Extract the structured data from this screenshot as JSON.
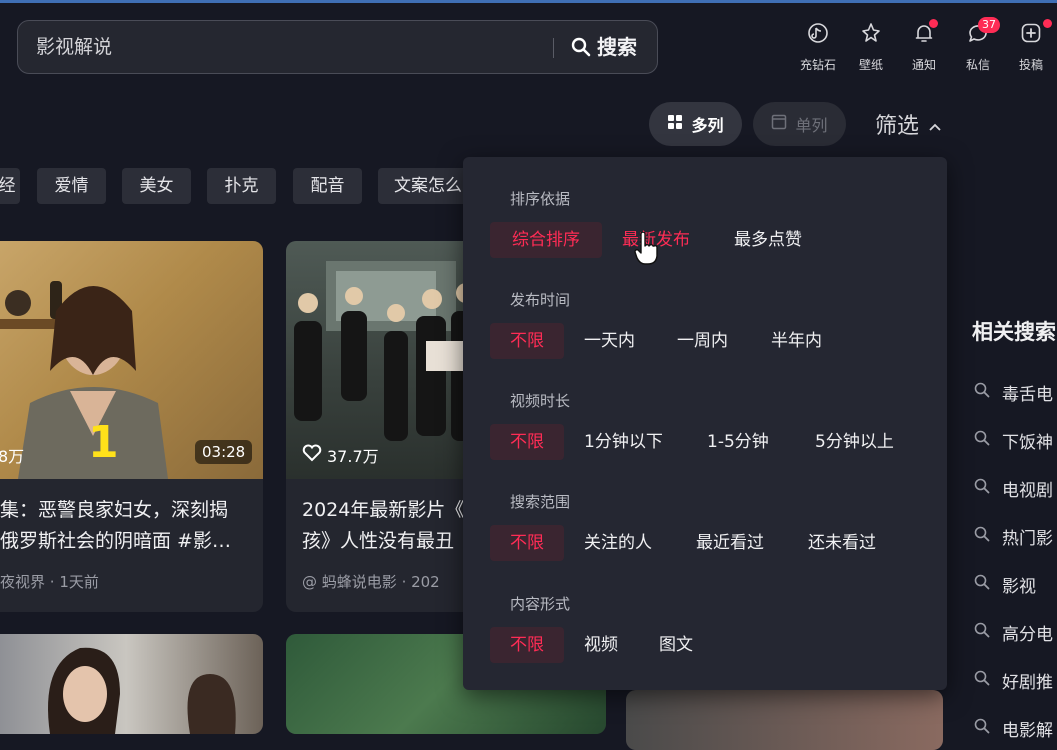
{
  "search": {
    "query": "影视解说",
    "button_label": "搜索"
  },
  "top_nav": [
    {
      "icon": "diamond-icon",
      "label": "充钻石"
    },
    {
      "icon": "wallpaper-icon",
      "label": "壁纸"
    },
    {
      "icon": "bell-icon",
      "label": "通知"
    },
    {
      "icon": "message-icon",
      "label": "私信",
      "badge": "37"
    },
    {
      "icon": "upload-icon",
      "label": "投稿"
    }
  ],
  "view_toggle": {
    "multi_label": "多列",
    "single_label": "单列"
  },
  "filter_label": "筛选",
  "tags": [
    "爱情",
    "美女",
    "扑克",
    "配音",
    "文案怎么"
  ],
  "cards": [
    {
      "likes": "8万",
      "duration": "03:28",
      "overlay_number": "1",
      "title_line1": "集：恶警良家妇女，深刻揭",
      "title_line2": "俄罗斯社会的阴暗面 #影…",
      "author": "夜视界",
      "time": "· 1天前"
    },
    {
      "likes": "37.7万",
      "title_line1": "2024年最新影片《",
      "title_line2": "孩》人性没有最丑",
      "author": "@ 蚂蜂说电影",
      "time": "· 202"
    }
  ],
  "related": {
    "title": "相关搜索",
    "items": [
      "毒舌电",
      "下饭神",
      "电视剧",
      "热门影",
      "影视",
      "高分电",
      "好剧推",
      "电影解"
    ]
  },
  "filter_panel": {
    "sort": {
      "title": "排序依据",
      "options": [
        "综合排序",
        "最新发布",
        "最多点赞"
      ],
      "selected": "综合排序",
      "hovered": "最新发布"
    },
    "publish_time": {
      "title": "发布时间",
      "options": [
        "不限",
        "一天内",
        "一周内",
        "半年内"
      ],
      "selected": "不限"
    },
    "duration": {
      "title": "视频时长",
      "options": [
        "不限",
        "1分钟以下",
        "1-5分钟",
        "5分钟以上"
      ],
      "selected": "不限"
    },
    "scope": {
      "title": "搜索范围",
      "options": [
        "不限",
        "关注的人",
        "最近看过",
        "还未看过"
      ],
      "selected": "不限"
    },
    "content_type": {
      "title": "内容形式",
      "options": [
        "不限",
        "视频",
        "图文"
      ],
      "selected": "不限"
    }
  },
  "colors": {
    "background": "#161823",
    "accent": "#fe2c55",
    "panel": "#252732"
  }
}
